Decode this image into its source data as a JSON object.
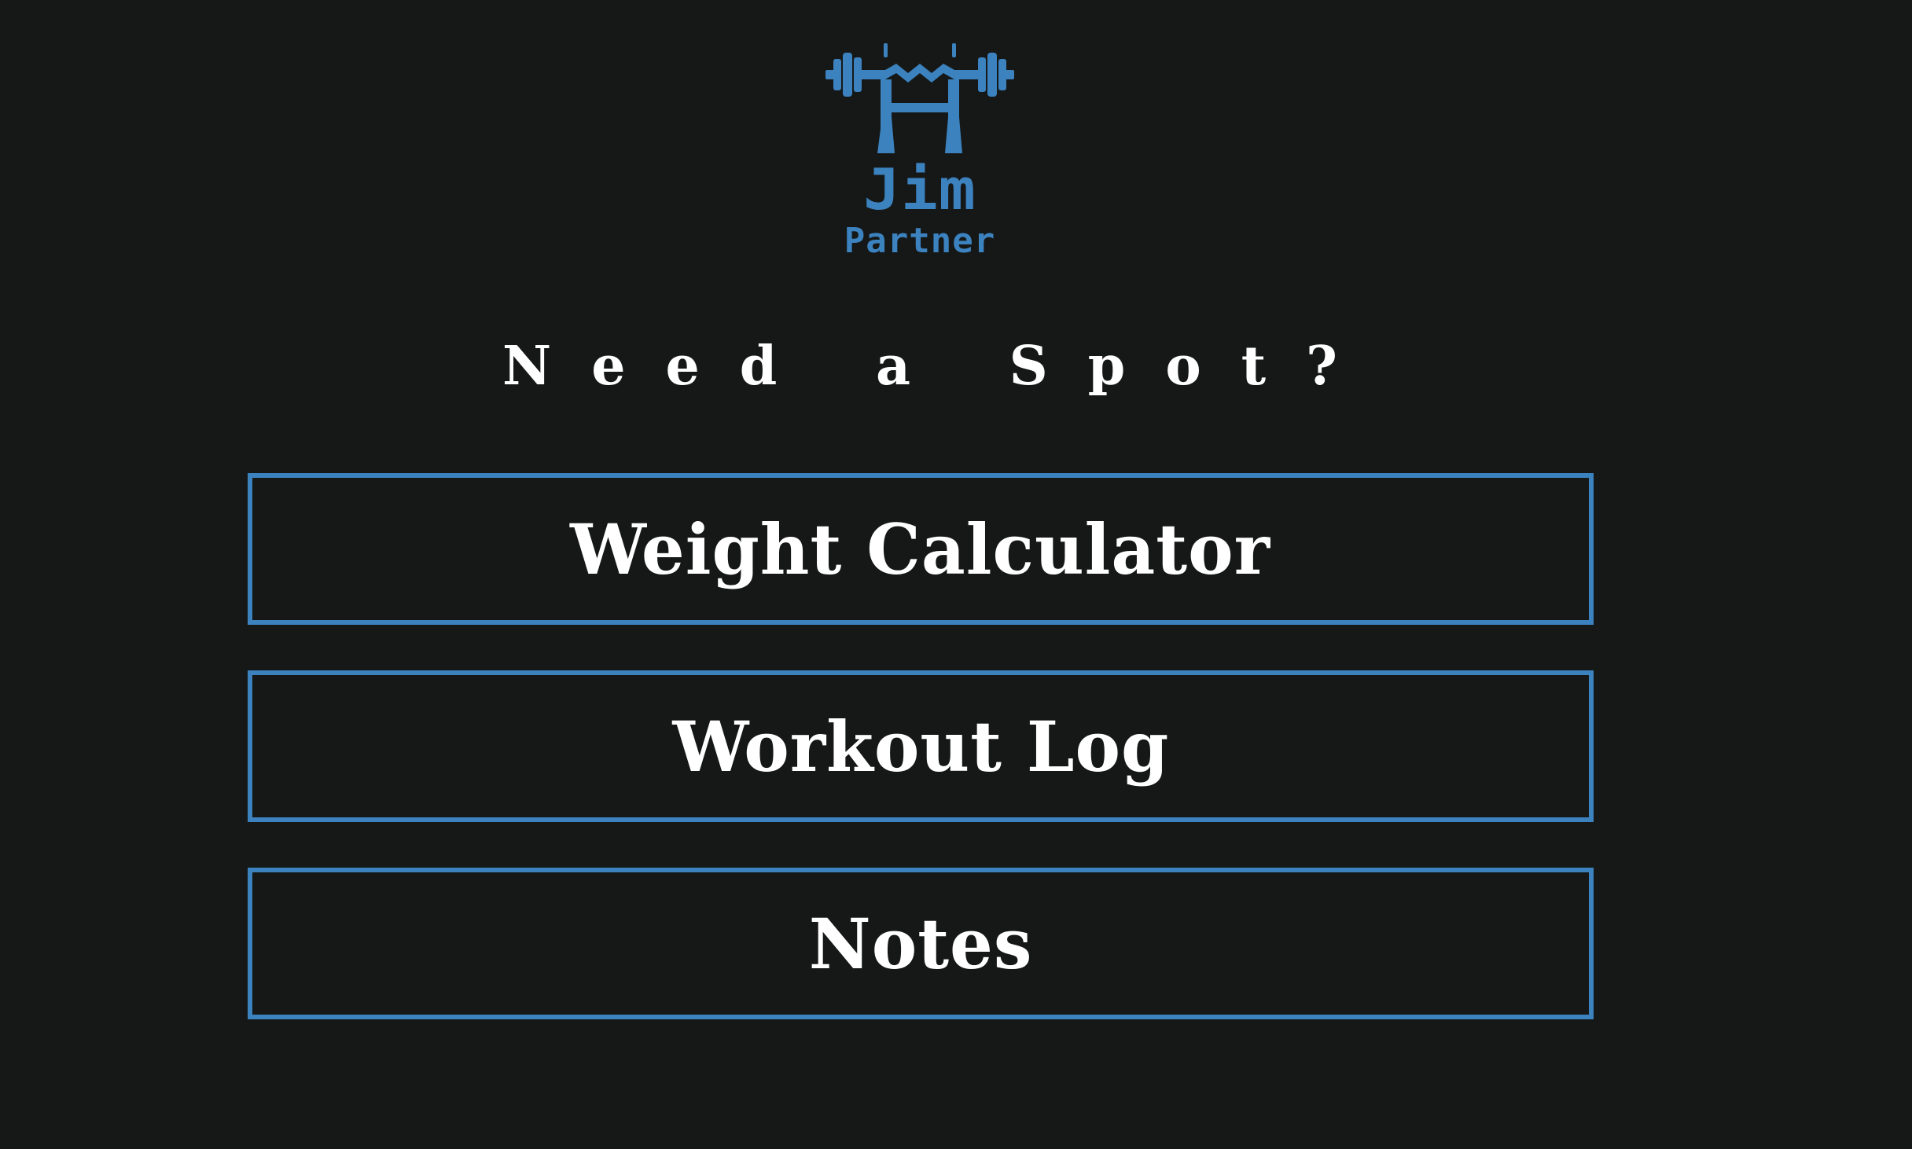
{
  "brand": {
    "logo_line1": "Jim",
    "logo_line2": "Partner",
    "icon": "barbell-rack-icon",
    "color": "#3b82bf"
  },
  "tagline": "Need a Spot?",
  "menu": {
    "items": [
      {
        "label": "Weight Calculator"
      },
      {
        "label": "Workout Log"
      },
      {
        "label": "Notes"
      }
    ],
    "border_color": "#3b82bf"
  },
  "colors": {
    "background": "#161818",
    "text": "#ffffff",
    "accent": "#3b82bf"
  }
}
